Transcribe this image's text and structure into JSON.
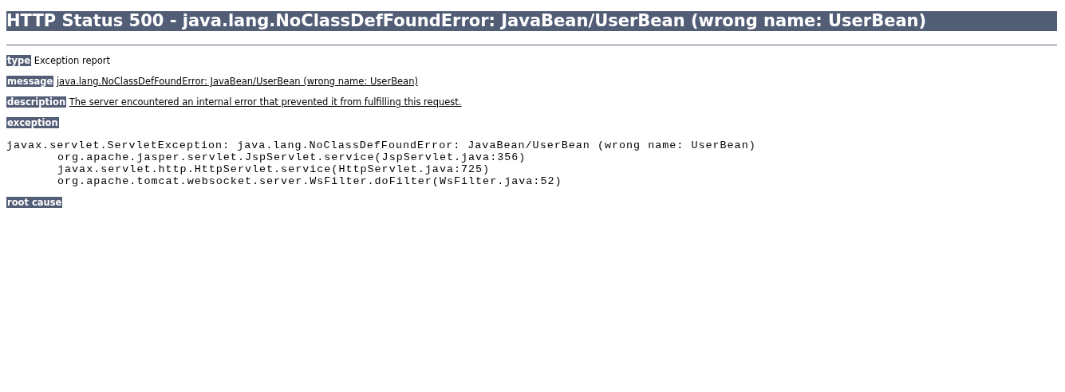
{
  "title": "HTTP Status 500 - java.lang.NoClassDefFoundError: JavaBean/UserBean (wrong name: UserBean)",
  "fields": [
    {
      "label": "type",
      "text": "Exception report",
      "kind": "plain"
    },
    {
      "label": "message",
      "text": "java.lang.NoClassDefFoundError: JavaBean/UserBean (wrong name: UserBean)",
      "kind": "underlined"
    },
    {
      "label": "description",
      "text": "The server encountered an internal error that prevented it from fulfilling this request.",
      "kind": "underlined"
    }
  ],
  "exception": {
    "label": "exception",
    "trace": [
      "javax.servlet.ServletException: java.lang.NoClassDefFoundError: JavaBean/UserBean (wrong name: UserBean)",
      "org.apache.jasper.servlet.JspServlet.service(JspServlet.java:356)",
      "javax.servlet.http.HttpServlet.service(HttpServlet.java:725)",
      "org.apache.tomcat.websocket.server.WsFilter.doFilter(WsFilter.java:52)"
    ]
  },
  "root_cause": {
    "label": "root cause"
  }
}
